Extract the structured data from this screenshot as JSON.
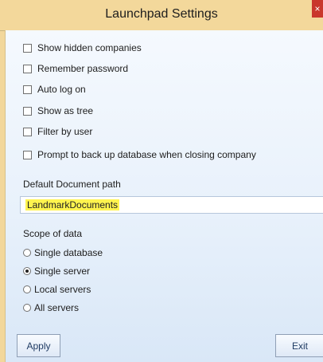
{
  "window": {
    "title": "Launchpad Settings",
    "close_label": "×"
  },
  "options": [
    {
      "label": "Show hidden companies",
      "checked": false
    },
    {
      "label": "Remember password",
      "checked": false
    },
    {
      "label": "Auto log on",
      "checked": false
    },
    {
      "label": "Show as tree",
      "checked": false
    },
    {
      "label": "Filter by user",
      "checked": false
    },
    {
      "label": "Prompt to back up database when closing company",
      "checked": false
    }
  ],
  "document": {
    "label": "Default Document path",
    "value": "LandmarkDocuments"
  },
  "scope": {
    "label": "Scope of data",
    "options": [
      {
        "label": "Single database",
        "selected": false
      },
      {
        "label": "Single server",
        "selected": true
      },
      {
        "label": "Local servers",
        "selected": false
      },
      {
        "label": "All servers",
        "selected": false
      }
    ]
  },
  "buttons": {
    "apply": "Apply",
    "exit": "Exit"
  }
}
